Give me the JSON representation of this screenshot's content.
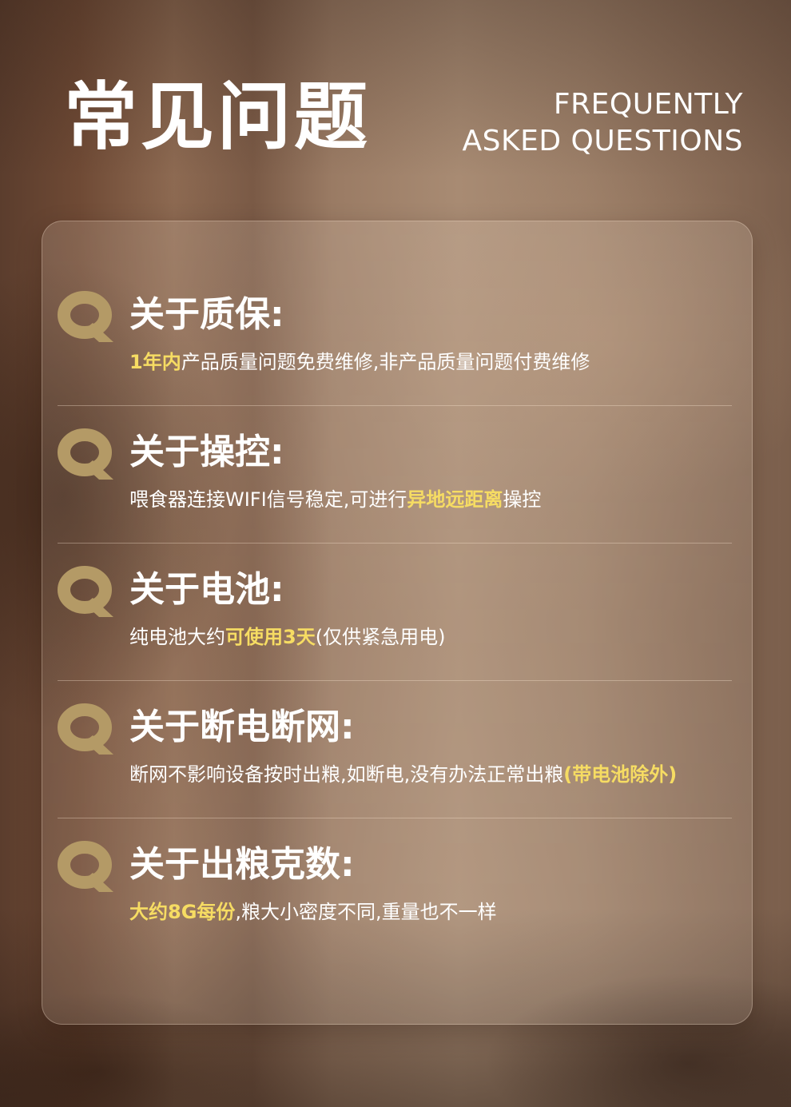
{
  "header": {
    "title_zh": "常见问题",
    "title_en_line1": "FREQUENTLY",
    "title_en_line2": "ASKED QUESTIONS"
  },
  "colors": {
    "q_icon": "#b49a66",
    "highlight": "#f6dc63",
    "text": "#ffffff"
  },
  "icons": {
    "q": "q-letter-icon"
  },
  "faq": [
    {
      "question": "关于质保:",
      "a1": "1年内",
      "a2": "产品质量问题免费维修,非产品质量问题付费维修"
    },
    {
      "question": "关于操控:",
      "a1": "喂食器连接WIFI信号稳定,可进行",
      "a2": "异地远距离",
      "a3": "操控"
    },
    {
      "question": "关于电池:",
      "a1": "纯电池大约",
      "a2": "可使用3天",
      "a3": "(仅供紧急用电)"
    },
    {
      "question": "关于断电断网:",
      "a1": "断网不影响设备按时出粮,如断电,没有办法正常出粮",
      "a2": "(带电池除外)"
    },
    {
      "question": "关于出粮克数:",
      "a1": "大约8G每份",
      "a2": ",粮大小密度不同,重量也不一样"
    }
  ]
}
